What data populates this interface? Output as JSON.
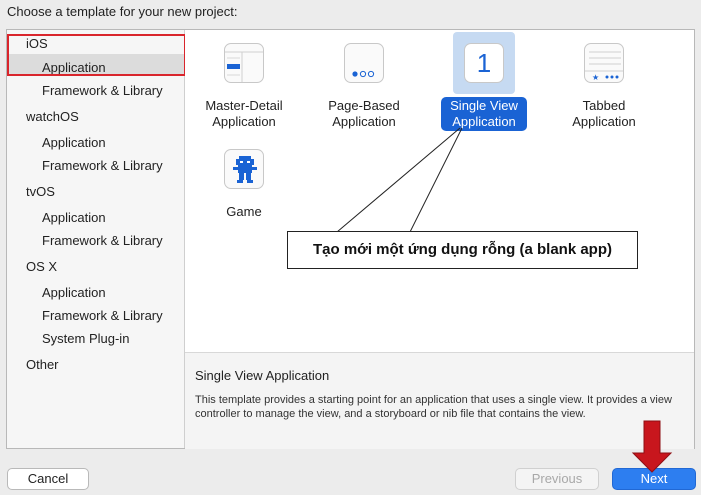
{
  "heading": "Choose a template for your new project:",
  "sidebar": {
    "items": [
      {
        "label": "iOS",
        "kind": "category"
      },
      {
        "label": "Application",
        "kind": "sub",
        "selected": true
      },
      {
        "label": "Framework & Library",
        "kind": "sub"
      },
      {
        "label": "watchOS",
        "kind": "category"
      },
      {
        "label": "Application",
        "kind": "sub"
      },
      {
        "label": "Framework & Library",
        "kind": "sub"
      },
      {
        "label": "tvOS",
        "kind": "category"
      },
      {
        "label": "Application",
        "kind": "sub"
      },
      {
        "label": "Framework & Library",
        "kind": "sub"
      },
      {
        "label": "OS X",
        "kind": "category"
      },
      {
        "label": "Application",
        "kind": "sub"
      },
      {
        "label": "Framework & Library",
        "kind": "sub"
      },
      {
        "label": "System Plug-in",
        "kind": "sub"
      },
      {
        "label": "Other",
        "kind": "category"
      }
    ]
  },
  "templates": {
    "master_detail": {
      "line1": "Master-Detail",
      "line2": "Application"
    },
    "page_based": {
      "line1": "Page-Based",
      "line2": "Application"
    },
    "single_view": {
      "line1": "Single View",
      "line2": "Application",
      "badge": "1",
      "selected": true
    },
    "tabbed": {
      "line1": "Tabbed",
      "line2": "Application"
    },
    "game": {
      "line1": "Game"
    }
  },
  "callout": "Tạo mới một ứng dụng rỗng (a blank app)",
  "description": {
    "title": "Single View Application",
    "text": "This template provides a starting point for an application that uses a single view. It provides a view controller to manage the view, and a storyboard or nib file that contains the view."
  },
  "buttons": {
    "cancel": "Cancel",
    "previous": "Previous",
    "next": "Next"
  },
  "colors": {
    "selection_blue": "#1a63d4",
    "highlight_red": "#d9252c",
    "arrow_red": "#c8161d"
  }
}
